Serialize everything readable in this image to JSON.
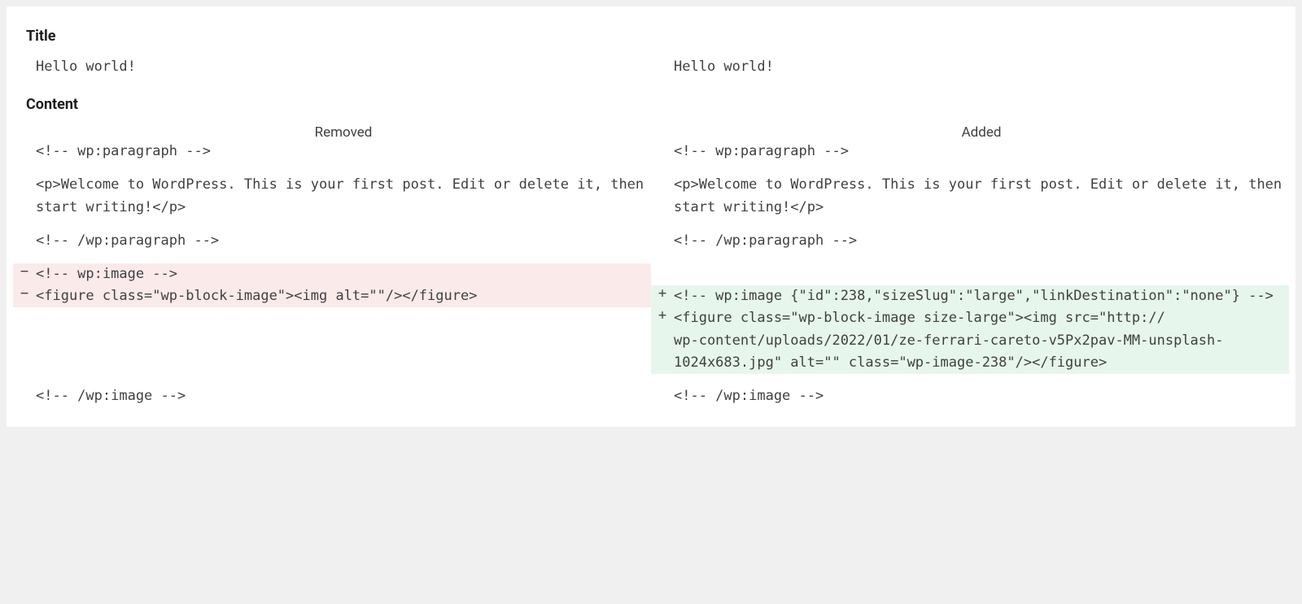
{
  "sections": {
    "title_label": "Title",
    "content_label": "Content"
  },
  "col_headings": {
    "removed": "Removed",
    "added": "Added"
  },
  "markers": {
    "minus": "−",
    "plus": "+"
  },
  "title_row": {
    "left": "Hello world!",
    "right": "Hello world!"
  },
  "content_rows": [
    {
      "type": "context",
      "left": "<!-- wp:paragraph -->",
      "right": "<!-- wp:paragraph -->"
    },
    {
      "type": "spacer"
    },
    {
      "type": "context",
      "left": "<p>Welcome to WordPress. This is your first post. Edit or delete it, then start writing!</p>",
      "right": "<p>Welcome to WordPress. This is your first post. Edit or delete it, then start writing!</p>"
    },
    {
      "type": "spacer"
    },
    {
      "type": "context",
      "left": "<!-- /wp:paragraph -->",
      "right": "<!-- /wp:paragraph -->"
    },
    {
      "type": "spacer"
    },
    {
      "type": "removed",
      "left": "<!-- wp:image -->",
      "right": ""
    },
    {
      "type": "changed",
      "left": "<figure class=\"wp-block-image\"><img alt=\"\"/></figure>",
      "right": "<!-- wp:image {\"id\":238,\"sizeSlug\":\"large\",\"linkDestination\":\"none\"} -->"
    },
    {
      "type": "added",
      "left": "",
      "right": "<figure class=\"wp-block-image size-large\"><img src=\"http://              wp-content/uploads/2022/01/ze-ferrari-careto-v5Px2pav-MM-unsplash-1024x683.jpg\" alt=\"\" class=\"wp-image-238\"/></figure>"
    },
    {
      "type": "spacer"
    },
    {
      "type": "context",
      "left": "<!-- /wp:image -->",
      "right": "<!-- /wp:image -->"
    }
  ]
}
